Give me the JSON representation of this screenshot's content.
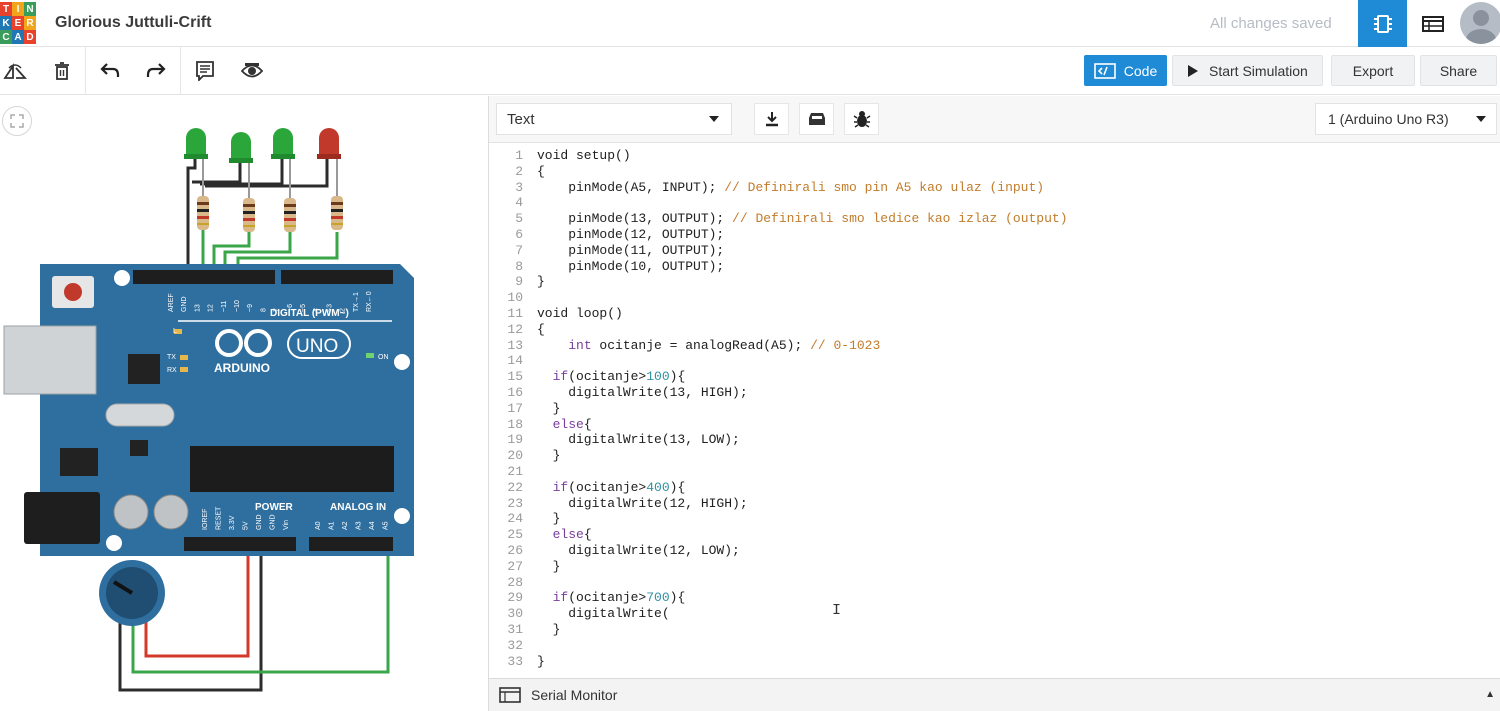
{
  "topbar": {
    "logo_letters": [
      "T",
      "I",
      "N",
      "K",
      "E",
      "R",
      "C",
      "A",
      "D"
    ],
    "logo_colors": [
      "#e8412c",
      "#f2a41d",
      "#3a9c5b",
      "#1f78b4",
      "#e8412c",
      "#f2a41d",
      "#3a9c5b",
      "#1f78b4",
      "#e8412c"
    ],
    "project_title": "Glorious Juttuli-Crift",
    "save_status": "All changes saved"
  },
  "toolbar": {
    "code_label": "Code",
    "simulate_label": "Start Simulation",
    "export_label": "Export",
    "share_label": "Share"
  },
  "code_panel": {
    "mode": "Text",
    "device": "1 (Arduino Uno R3)",
    "serial_monitor": "Serial Monitor"
  },
  "board": {
    "name": "ARDUINO",
    "model": "UNO",
    "digital_label": "DIGITAL (PWM~)",
    "power_label": "POWER",
    "analog_label": "ANALOG IN",
    "on_label": "ON",
    "l_label": "L",
    "tx_label": "TX",
    "rx_label": "RX",
    "digital_pins": [
      "AREF",
      "GND",
      "13",
      "12",
      "~11",
      "~10",
      "~9",
      "8",
      "7",
      "~6",
      "~5",
      "4",
      "~3",
      "2",
      "TX→1",
      "RX←0"
    ],
    "power_pins": [
      "IOREF",
      "RESET",
      "3.3V",
      "5V",
      "GND",
      "GND",
      "Vin"
    ],
    "analog_pins": [
      "A0",
      "A1",
      "A2",
      "A3",
      "A4",
      "A5"
    ]
  },
  "colors": {
    "accent": "#1f8ad6",
    "board": "#2f6f9f",
    "led_green": "#2aa63a",
    "led_red": "#c0392b",
    "wire_green": "#3aa64a",
    "wire_red": "#d43a2a",
    "wire_black": "#2c2c2c"
  },
  "code_lines": [
    [
      {
        "t": "void setup()",
        "c": "#202020"
      }
    ],
    [
      {
        "t": "{",
        "c": "#202020"
      }
    ],
    [
      {
        "t": "    pinMode(A5, INPUT); ",
        "c": "#202020"
      },
      {
        "t": "// Definirali smo pin A5 kao ulaz (input)",
        "c": "#c27c2c"
      }
    ],
    [],
    [
      {
        "t": "    pinMode(13, OUTPUT); ",
        "c": "#202020"
      },
      {
        "t": "// Definirali smo ledice kao izlaz (output)",
        "c": "#c27c2c"
      }
    ],
    [
      {
        "t": "    pinMode(12, OUTPUT);",
        "c": "#202020"
      }
    ],
    [
      {
        "t": "    pinMode(11, OUTPUT);",
        "c": "#202020"
      }
    ],
    [
      {
        "t": "    pinMode(10, OUTPUT);",
        "c": "#202020"
      }
    ],
    [
      {
        "t": "}",
        "c": "#202020"
      }
    ],
    [],
    [
      {
        "t": "void loop()",
        "c": "#202020"
      }
    ],
    [
      {
        "t": "{",
        "c": "#202020"
      }
    ],
    [
      {
        "t": "    ",
        "c": "#202020"
      },
      {
        "t": "int",
        "c": "#7a3e9d"
      },
      {
        "t": " ocitanje = analogRead(A5); ",
        "c": "#202020"
      },
      {
        "t": "// 0-1023",
        "c": "#c27c2c"
      }
    ],
    [],
    [
      {
        "t": "  ",
        "c": "#202020"
      },
      {
        "t": "if",
        "c": "#7a3e9d"
      },
      {
        "t": "(ocitanje>",
        "c": "#202020"
      },
      {
        "t": "100",
        "c": "#2f8fa3"
      },
      {
        "t": "){",
        "c": "#202020"
      }
    ],
    [
      {
        "t": "    digitalWrite(13, HIGH);",
        "c": "#202020"
      }
    ],
    [
      {
        "t": "  }",
        "c": "#202020"
      }
    ],
    [
      {
        "t": "  ",
        "c": "#202020"
      },
      {
        "t": "else",
        "c": "#7a3e9d"
      },
      {
        "t": "{",
        "c": "#202020"
      }
    ],
    [
      {
        "t": "    digitalWrite(13, LOW);",
        "c": "#202020"
      }
    ],
    [
      {
        "t": "  }",
        "c": "#202020"
      }
    ],
    [],
    [
      {
        "t": "  ",
        "c": "#202020"
      },
      {
        "t": "if",
        "c": "#7a3e9d"
      },
      {
        "t": "(ocitanje>",
        "c": "#202020"
      },
      {
        "t": "400",
        "c": "#2f8fa3"
      },
      {
        "t": "){",
        "c": "#202020"
      }
    ],
    [
      {
        "t": "    digitalWrite(12, HIGH);",
        "c": "#202020"
      }
    ],
    [
      {
        "t": "  }",
        "c": "#202020"
      }
    ],
    [
      {
        "t": "  ",
        "c": "#202020"
      },
      {
        "t": "else",
        "c": "#7a3e9d"
      },
      {
        "t": "{",
        "c": "#202020"
      }
    ],
    [
      {
        "t": "    digitalWrite(12, LOW);",
        "c": "#202020"
      }
    ],
    [
      {
        "t": "  }",
        "c": "#202020"
      }
    ],
    [],
    [
      {
        "t": "  ",
        "c": "#202020"
      },
      {
        "t": "if",
        "c": "#7a3e9d"
      },
      {
        "t": "(ocitanje>",
        "c": "#202020"
      },
      {
        "t": "700",
        "c": "#2f8fa3"
      },
      {
        "t": "){",
        "c": "#202020"
      }
    ],
    [
      {
        "t": "    digitalWrite(",
        "c": "#202020"
      }
    ],
    [
      {
        "t": "  }",
        "c": "#202020"
      }
    ],
    [],
    [
      {
        "t": "}",
        "c": "#202020"
      }
    ]
  ]
}
